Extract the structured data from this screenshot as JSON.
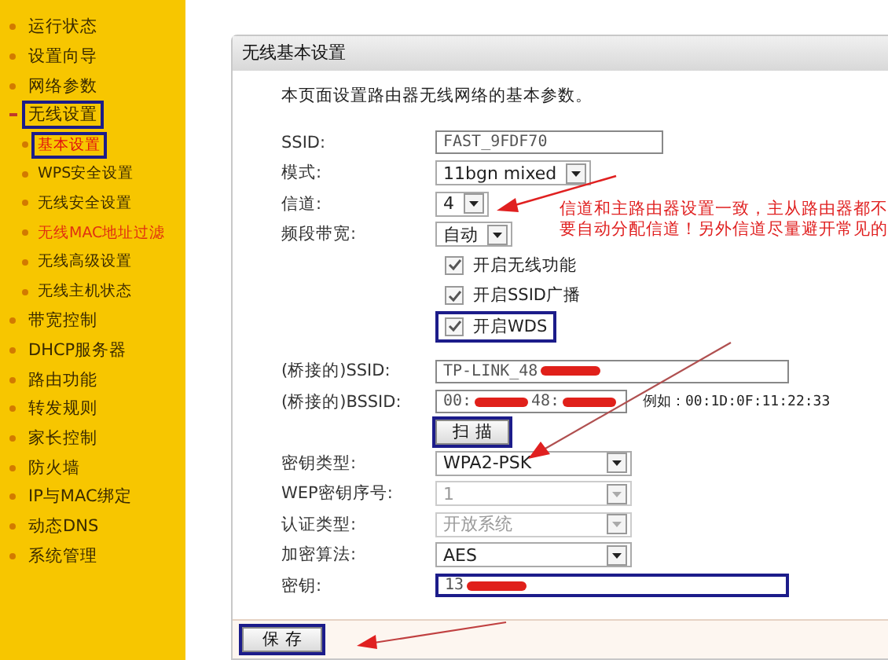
{
  "sidebar": {
    "items": [
      {
        "label": "运行状态",
        "selected": false,
        "visited": false,
        "highlighted": false
      },
      {
        "label": "设置向导",
        "selected": false,
        "visited": false,
        "highlighted": false
      },
      {
        "label": "网络参数",
        "selected": false,
        "visited": false,
        "highlighted": false
      },
      {
        "label": "无线设置",
        "selected": false,
        "visited": false,
        "highlighted": true,
        "expanded": true,
        "children": [
          {
            "label": "基本设置",
            "selected": true,
            "visited": false,
            "highlighted": true
          },
          {
            "label": "WPS安全设置",
            "selected": false,
            "visited": false,
            "highlighted": false
          },
          {
            "label": "无线安全设置",
            "selected": false,
            "visited": false,
            "highlighted": false
          },
          {
            "label": "无线MAC地址过滤",
            "selected": false,
            "visited": true,
            "highlighted": false
          },
          {
            "label": "无线高级设置",
            "selected": false,
            "visited": false,
            "highlighted": false
          },
          {
            "label": "无线主机状态",
            "selected": false,
            "visited": false,
            "highlighted": false
          }
        ]
      },
      {
        "label": "带宽控制",
        "selected": false,
        "visited": false,
        "highlighted": false
      },
      {
        "label": "DHCP服务器",
        "selected": false,
        "visited": false,
        "highlighted": false
      },
      {
        "label": "路由功能",
        "selected": false,
        "visited": false,
        "highlighted": false
      },
      {
        "label": "转发规则",
        "selected": false,
        "visited": false,
        "highlighted": false
      },
      {
        "label": "家长控制",
        "selected": false,
        "visited": false,
        "highlighted": false
      },
      {
        "label": "防火墙",
        "selected": false,
        "visited": false,
        "highlighted": false
      },
      {
        "label": "IP与MAC绑定",
        "selected": false,
        "visited": false,
        "highlighted": false
      },
      {
        "label": "动态DNS",
        "selected": false,
        "visited": false,
        "highlighted": false
      },
      {
        "label": "系统管理",
        "selected": false,
        "visited": false,
        "highlighted": false
      }
    ]
  },
  "panel": {
    "title": "无线基本设置",
    "description": "本页面设置路由器无线网络的基本参数。",
    "fields": [
      {
        "kind": "text",
        "label": "SSID:",
        "value": "FAST_9FDF70",
        "highlighted": false
      },
      {
        "kind": "select",
        "label": "模式:",
        "value": "11bgn mixed",
        "disabled": false
      },
      {
        "kind": "select",
        "label": "信道:",
        "value": "4",
        "disabled": false
      },
      {
        "kind": "select",
        "label": "频段带宽:",
        "value": "自动",
        "disabled": false
      },
      {
        "kind": "checkbox",
        "label": "开启无线功能",
        "checked": true
      },
      {
        "kind": "checkbox",
        "label": "开启SSID广播",
        "checked": true
      },
      {
        "kind": "checkbox",
        "label": "开启WDS",
        "checked": true,
        "highlighted": true
      },
      {
        "kind": "gap"
      },
      {
        "kind": "redacted",
        "label": "(桥接的)SSID:",
        "value_parts": [
          "TP-LINK_48"
        ],
        "highlighted": false
      },
      {
        "kind": "redacted",
        "label": "(桥接的)BSSID:",
        "value_parts": [
          "00:",
          "48:"
        ],
        "hint": "例如：00:1D:0F:11:22:33",
        "highlighted": false
      },
      {
        "kind": "button",
        "label": "扫 描",
        "highlighted": true
      },
      {
        "kind": "select",
        "label": "密钥类型:",
        "value": "WPA2-PSK",
        "disabled": false
      },
      {
        "kind": "select",
        "label": "WEP密钥序号:",
        "value": "1",
        "disabled": true
      },
      {
        "kind": "select",
        "label": "认证类型:",
        "value": "开放系统",
        "disabled": true
      },
      {
        "kind": "select",
        "label": "加密算法:",
        "value": "AES",
        "disabled": false
      },
      {
        "kind": "redacted",
        "label": "密钥:",
        "value_parts": [
          "13"
        ],
        "highlighted": true
      }
    ],
    "save_button": {
      "label": "保 存",
      "highlighted": true
    }
  },
  "annotation": {
    "text": "信道和主路由器设置一致，主从路由器都不要自动分配信道！另外信道尽量避开常见的"
  }
}
